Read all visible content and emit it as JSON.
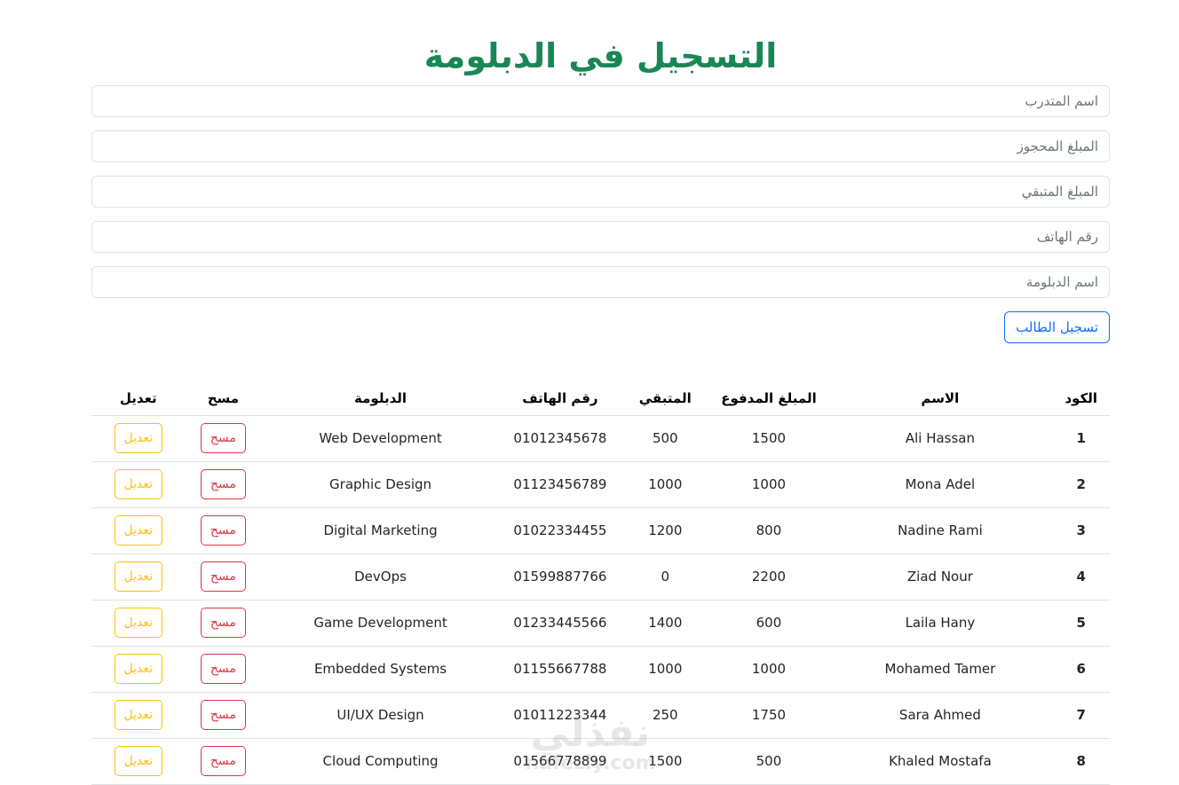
{
  "header": {
    "title": "التسجيل في الدبلومة"
  },
  "form": {
    "fields": [
      {
        "name": "trainee-name",
        "placeholder": "اسم المتدرب",
        "value": ""
      },
      {
        "name": "amount-booked",
        "placeholder": "المبلغ المحجوز",
        "value": ""
      },
      {
        "name": "amount-remaining",
        "placeholder": "المبلغ المتبقي",
        "value": ""
      },
      {
        "name": "phone-number",
        "placeholder": "رقم الهاتف",
        "value": ""
      },
      {
        "name": "diploma-name",
        "placeholder": "اسم الدبلومة",
        "value": ""
      }
    ],
    "submit_label": "تسجيل الطالب"
  },
  "table": {
    "headers": {
      "id": "الكود",
      "name": "الاسم",
      "paid": "المبلغ المدفوع",
      "remaining": "المتبقي",
      "phone": "رقم الهاتف",
      "diploma": "الدبلومة",
      "delete": "مسح",
      "edit": "تعديل"
    },
    "delete_label": "مسح",
    "edit_label": "تعديل",
    "rows": [
      {
        "id": "1",
        "name": "Ali Hassan",
        "paid": "1500",
        "remaining": "500",
        "phone": "01012345678",
        "diploma": "Web Development"
      },
      {
        "id": "2",
        "name": "Mona Adel",
        "paid": "1000",
        "remaining": "1000",
        "phone": "01123456789",
        "diploma": "Graphic Design"
      },
      {
        "id": "3",
        "name": "Nadine Rami",
        "paid": "800",
        "remaining": "1200",
        "phone": "01022334455",
        "diploma": "Digital Marketing"
      },
      {
        "id": "4",
        "name": "Ziad Nour",
        "paid": "2200",
        "remaining": "0",
        "phone": "01599887766",
        "diploma": "DevOps"
      },
      {
        "id": "5",
        "name": "Laila Hany",
        "paid": "600",
        "remaining": "1400",
        "phone": "01233445566",
        "diploma": "Game Development"
      },
      {
        "id": "6",
        "name": "Mohamed Tamer",
        "paid": "1000",
        "remaining": "1000",
        "phone": "01155667788",
        "diploma": "Embedded Systems"
      },
      {
        "id": "7",
        "name": "Sara Ahmed",
        "paid": "1750",
        "remaining": "250",
        "phone": "01011223344",
        "diploma": "UI/UX Design"
      },
      {
        "id": "8",
        "name": "Khaled Mostafa",
        "paid": "500",
        "remaining": "1500",
        "phone": "01566778899",
        "diploma": "Cloud Computing"
      }
    ]
  },
  "watermark": {
    "arabic": "نفذلي",
    "latin": "nafezly.com"
  },
  "colors": {
    "title": "#198754",
    "submit": "#0d6efd",
    "delete": "#dc3545",
    "edit": "#ffc107"
  }
}
